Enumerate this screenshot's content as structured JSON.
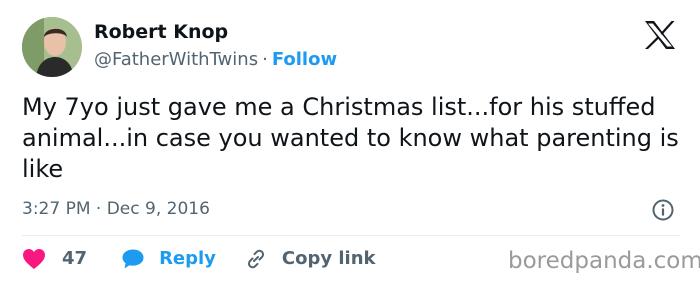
{
  "author": {
    "name": "Robert Knop",
    "handle": "@FatherWithTwins",
    "separator": "·",
    "follow_label": "Follow"
  },
  "header": {
    "logo_icon": "x-logo-icon"
  },
  "tweet": {
    "text": "My 7yo just gave me a Christmas list...for his stuffed animal...in case you wanted to know what parenting is like",
    "timestamp": "3:27 PM · Dec 9, 2016",
    "info_icon": "info-icon"
  },
  "actions": {
    "like_count": "47",
    "reply_label": "Reply",
    "copy_link_label": "Copy link",
    "like_icon": "heart-icon",
    "reply_icon": "speech-bubble-icon",
    "copy_icon": "link-icon"
  },
  "watermark": {
    "text": "boredpanda.com"
  },
  "colors": {
    "accent": "#1d9bf0",
    "like": "#f91880",
    "text": "#0f1419",
    "secondary": "#536471",
    "watermark": "#9a9a9a"
  }
}
